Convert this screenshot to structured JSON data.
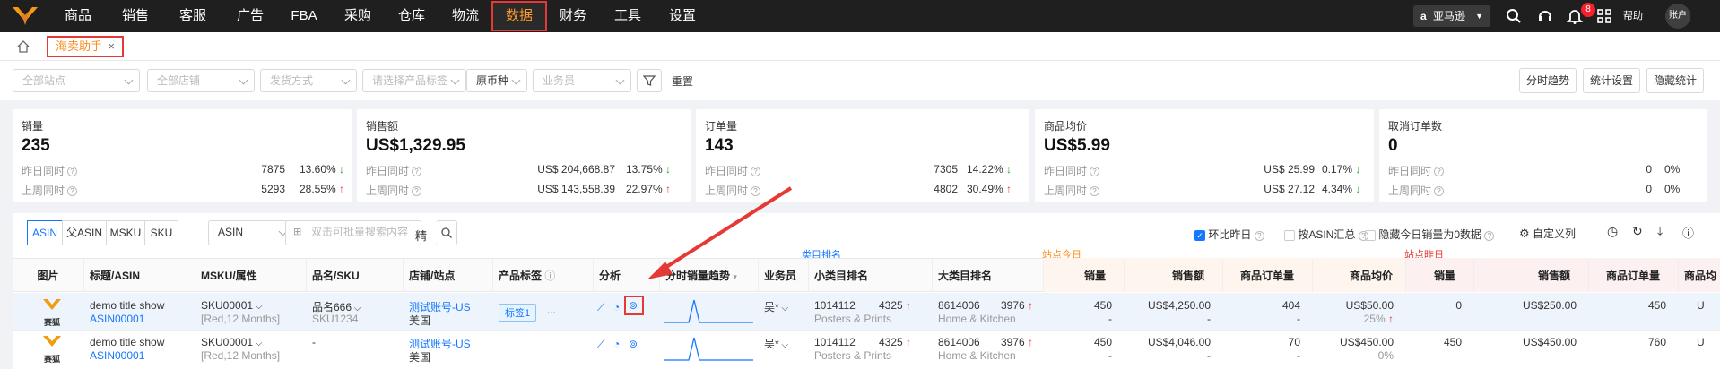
{
  "nav": {
    "items": [
      "商品",
      "销售",
      "客服",
      "广告",
      "FBA",
      "采购",
      "仓库",
      "物流",
      "数据",
      "财务",
      "工具",
      "设置"
    ],
    "active": "数据"
  },
  "top": {
    "marketplace": "亚马逊",
    "notification_count": "8",
    "help": "帮助",
    "account": "账户"
  },
  "page_tab": {
    "label": "海卖助手",
    "close": "×"
  },
  "filters": {
    "site": "全部站点",
    "store": "全部店铺",
    "shipping": "发货方式",
    "tags": "请选择产品标签",
    "currency": "原币种",
    "salesperson": "业务员",
    "reset": "重置"
  },
  "actions": {
    "time_trend": "分时趋势",
    "stat_settings": "统计设置",
    "hide_stats": "隐藏统计"
  },
  "kpis": [
    {
      "title": "销量",
      "value": "235",
      "l1": "昨日同时",
      "n1": "7875",
      "p1": "13.60%",
      "d1": "down",
      "l2": "上周同时",
      "n2": "5293",
      "p2": "28.55%",
      "d2": "up"
    },
    {
      "title": "销售额",
      "value": "US$1,329.95",
      "l1": "昨日同时",
      "n1": "US$ 204,668.87",
      "p1": "13.75%",
      "d1": "down",
      "l2": "上周同时",
      "n2": "US$ 143,558.39",
      "p2": "22.97%",
      "d2": "up"
    },
    {
      "title": "订单量",
      "value": "143",
      "l1": "昨日同时",
      "n1": "7305",
      "p1": "14.22%",
      "d1": "down",
      "l2": "上周同时",
      "n2": "4802",
      "p2": "30.49%",
      "d2": "up"
    },
    {
      "title": "商品均价",
      "value": "US$5.99",
      "l1": "昨日同时",
      "n1": "US$ 25.99",
      "p1": "0.17%",
      "d1": "down",
      "l2": "上周同时",
      "n2": "US$ 27.12",
      "p2": "4.34%",
      "d2": "down"
    },
    {
      "title": "取消订单数",
      "value": "0",
      "l1": "昨日同时",
      "n1": "0",
      "p1": "0%",
      "d1": "",
      "l2": "上周同时",
      "n2": "0",
      "p2": "0%",
      "d2": ""
    }
  ],
  "table_tools": {
    "seg": [
      "ASIN",
      "父ASIN",
      "MSKU",
      "SKU"
    ],
    "search_field": "ASIN",
    "search_placeholder": "双击可批量搜索内容",
    "exact": "精",
    "mom": "环比昨日",
    "by_asin": "按ASIN汇总",
    "hide_zero": "隐藏今日销量为0数据",
    "custom_cols": "自定义列"
  },
  "groups": {
    "small_rank": "类目排名",
    "today": "站点今日",
    "yesterday": "站点昨日"
  },
  "columns": [
    "图片",
    "标题/ASIN",
    "MSKU/属性",
    "品名/SKU",
    "店铺/站点",
    "产品标签",
    "分析",
    "分时销量趋势",
    "业务员",
    "小类目排名",
    "大类目排名",
    "销量",
    "销售额",
    "商品订单量",
    "商品均价",
    "销量",
    "销售额",
    "商品订单量",
    "商品均"
  ],
  "rows": [
    {
      "img": "赛狐",
      "title": "demo title show",
      "asin": "ASIN00001",
      "msku": "SKU00001",
      "attr": "[Red,12 Months]",
      "name": "品名666",
      "sku": "SKU1234",
      "store": "测试账号-US",
      "site": "美国",
      "tag": "标签1",
      "tag_more": "...",
      "sales_rep": "吴*",
      "small_rank": "1014112",
      "small_rank2": "4325",
      "small_cat": "Posters & Prints",
      "big_rank": "8614006",
      "big_rank2": "3976",
      "big_cat": "Home & Kitchen",
      "t_qty": "450",
      "t_amt": "US$4,250.00",
      "t_orders": "404",
      "t_avg": "US$50.00",
      "t_avg_pct": "25%",
      "y_qty": "0",
      "y_amt": "US$250.00",
      "y_orders": "450",
      "y_avg": "U"
    },
    {
      "img": "赛狐",
      "title": "demo title show",
      "asin": "ASIN00001",
      "msku": "SKU00001",
      "attr": "[Red,12 Months]",
      "name": "-",
      "sku": "",
      "store": "测试账号-US",
      "site": "美国",
      "tag": "",
      "tag_more": "",
      "sales_rep": "吴*",
      "small_rank": "1014112",
      "small_rank2": "4325",
      "small_cat": "Posters & Prints",
      "big_rank": "8614006",
      "big_rank2": "3976",
      "big_cat": "Home & Kitchen",
      "t_qty": "450",
      "t_amt": "US$4,046.00",
      "t_orders": "70",
      "t_avg": "US$450.00",
      "t_avg_pct": "0%",
      "y_qty": "450",
      "y_amt": "US$450.00",
      "y_orders": "760",
      "y_avg": "U"
    }
  ],
  "dash": "-"
}
